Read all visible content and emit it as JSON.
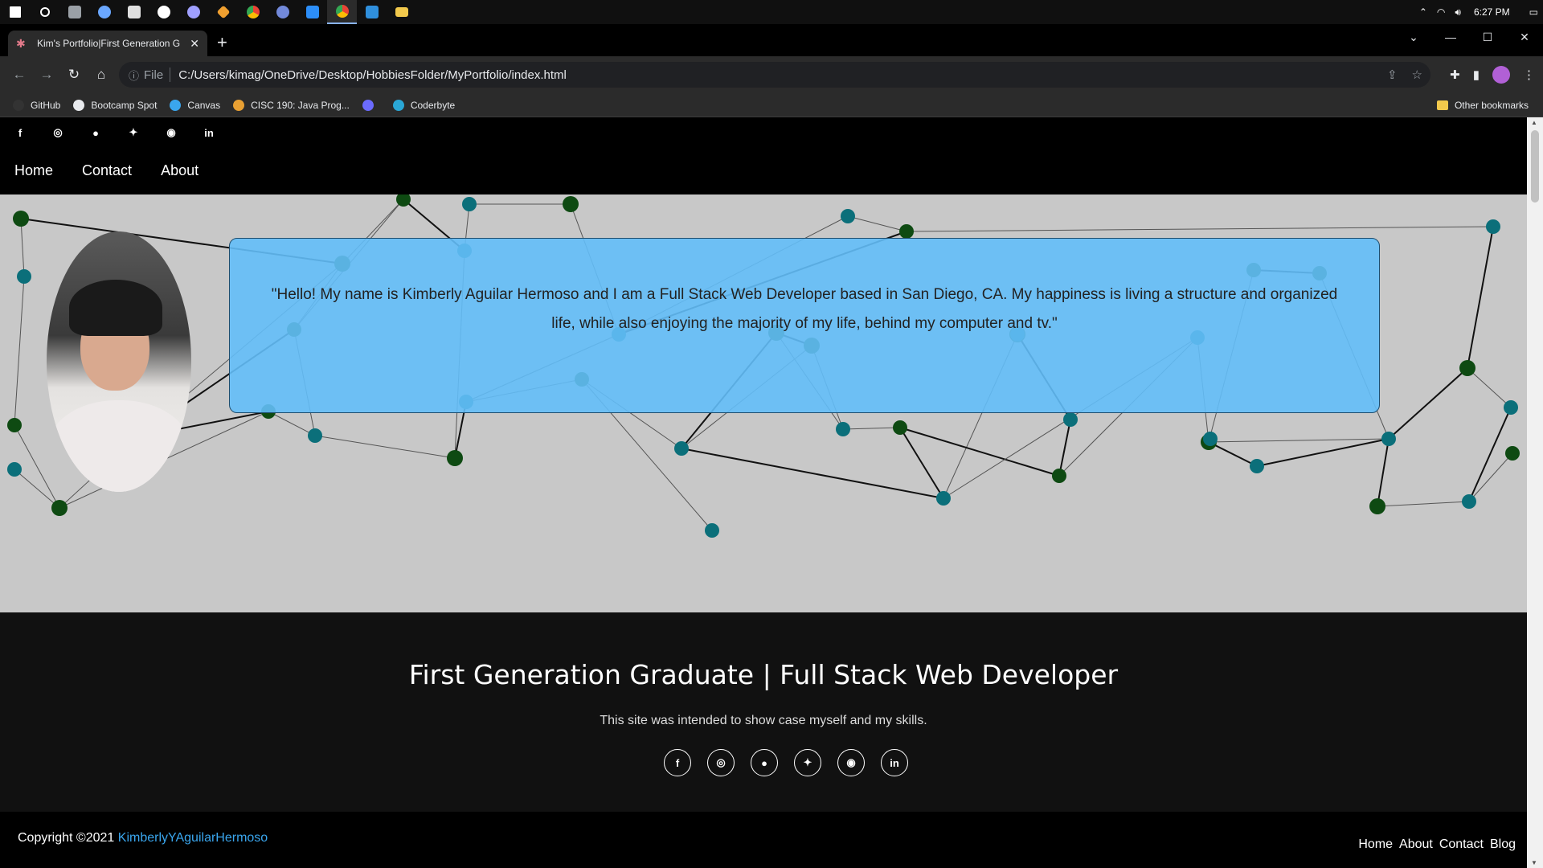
{
  "taskbar": {
    "apps": [
      {
        "name": "windows-start-icon",
        "color": "#ffffff"
      },
      {
        "name": "search-icon",
        "color": "#ffffff"
      },
      {
        "name": "file-manager-icon",
        "color": "#9aa0a6"
      },
      {
        "name": "app-circle-icon",
        "color": "#6aa7ff"
      },
      {
        "name": "cloud-app-icon",
        "color": "#e0e0e0"
      },
      {
        "name": "app-white-icon",
        "color": "#ffffff"
      },
      {
        "name": "obs-icon",
        "color": "#a0a0ff"
      },
      {
        "name": "git-icon",
        "color": "#f0a030"
      },
      {
        "name": "chrome-icon",
        "color": "#4caf50"
      },
      {
        "name": "discord-icon",
        "color": "#7289da"
      },
      {
        "name": "mail-icon",
        "color": "#2c8ef8"
      },
      {
        "name": "chrome-active-icon",
        "color": "#4caf50"
      },
      {
        "name": "vscode-icon",
        "color": "#2f8fdc"
      },
      {
        "name": "folder-icon",
        "color": "#f2c94c"
      }
    ],
    "clock": "6:27 PM"
  },
  "browser": {
    "tab_title": "Kim's Portfolio|First Generation G",
    "address_scheme": "File",
    "address": "C:/Users/kimag/OneDrive/Desktop/HobbiesFolder/MyPortfolio/index.html",
    "bookmarks": [
      {
        "label": "GitHub",
        "color": "#333333"
      },
      {
        "label": "Bootcamp Spot",
        "color": "#e8eaed"
      },
      {
        "label": "Canvas",
        "color": "#3aa6ee"
      },
      {
        "label": "CISC 190: Java Prog...",
        "color": "#e8a033"
      },
      {
        "label": "",
        "color": "#6b6bff"
      },
      {
        "label": "Coderbyte",
        "color": "#2aa7d6"
      }
    ],
    "other_bookmarks": "Other bookmarks"
  },
  "site": {
    "nav": [
      "Home",
      "Contact",
      "About"
    ],
    "bio": "\"Hello! My name is Kimberly Aguilar Hermoso and I am a Full Stack Web Developer based in San Diego, CA. My happiness is living a structure and organized life, while also enjoying the majority of my life, behind my computer and tv.\"",
    "headline": "First Generation Graduate | Full Stack Web Developer",
    "subline": "This site was intended to show case myself and my skills.",
    "social": [
      "facebook-icon",
      "instagram-icon",
      "user-circle-icon",
      "twitter-icon",
      "github-icon",
      "linkedin-icon"
    ],
    "copyright_prefix": "Copyright ©2021",
    "copyright_link": "KimberlyYAguilarHermoso",
    "footer_nav": [
      "Home",
      "About",
      "Contact",
      "Blog"
    ]
  },
  "colors": {
    "bio_panel": "#63bef8",
    "link": "#3aa6ee",
    "node_dark": "#0e4a12",
    "node_teal": "#0b6f7a"
  }
}
